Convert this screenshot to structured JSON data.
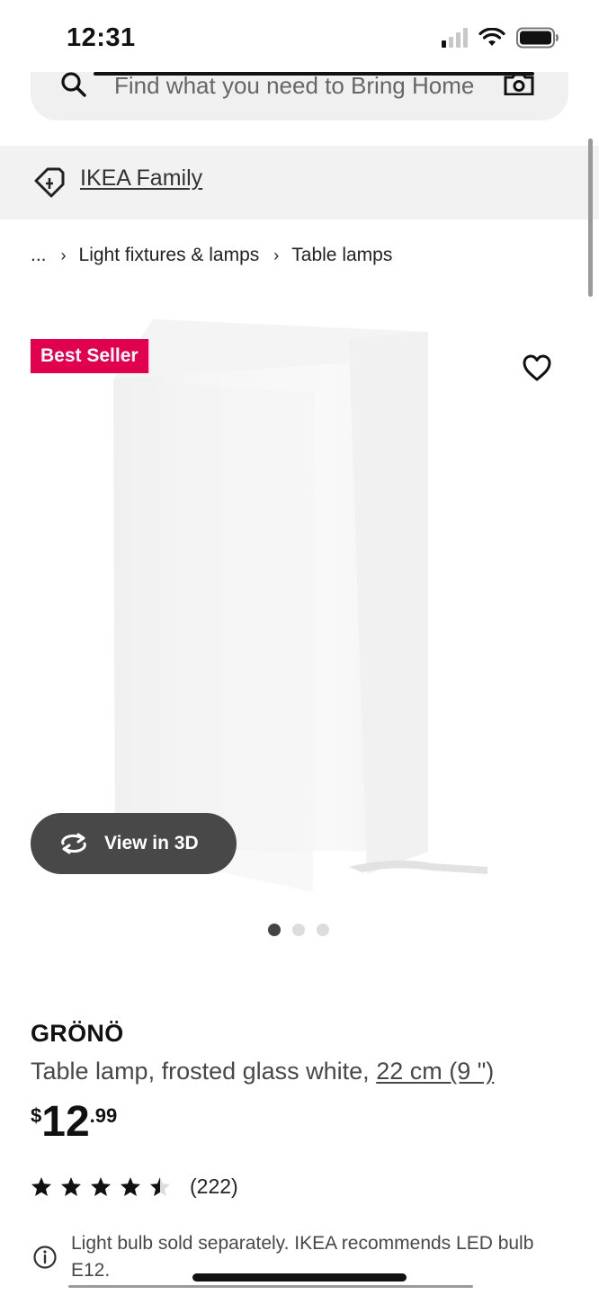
{
  "status_bar": {
    "time": "12:31",
    "icons": [
      "cellular-signal-icon",
      "wifi-icon",
      "battery-icon"
    ]
  },
  "search": {
    "placeholder": "Find what you need to Bring Home",
    "icons": [
      "search-icon",
      "camera-icon"
    ]
  },
  "family": {
    "label": "IKEA Family",
    "icon": "ikea-family-tag-icon"
  },
  "breadcrumb": {
    "items": [
      "...",
      "Light fixtures & lamps",
      "Table lamps"
    ]
  },
  "product": {
    "badge": "Best Seller",
    "name": "GRÖNÖ",
    "description": "Table lamp, frosted glass white, ",
    "size": "22 cm (9 \")",
    "price": {
      "currency": "$",
      "integer": "12",
      "decimal": ".99"
    },
    "rating": {
      "stars": 4.5,
      "max": 5,
      "count": "(222)"
    },
    "info": "Light bulb sold separately. IKEA recommends LED bulb E12.",
    "view_3d_label": "View in 3D"
  },
  "carousel": {
    "total": 3,
    "active_index": 0
  },
  "colors": {
    "badge": "#e0004d",
    "view3d_button": "#484848",
    "text_primary": "#111111",
    "text_secondary": "#484848"
  }
}
